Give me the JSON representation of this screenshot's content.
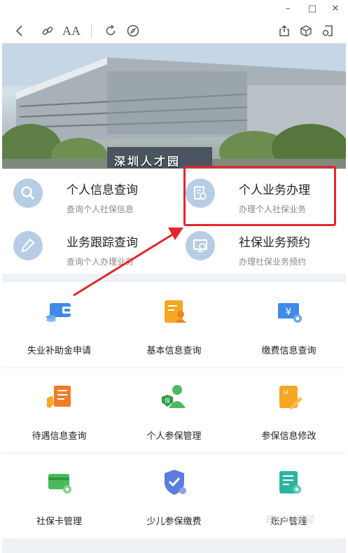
{
  "window": {
    "controls": [
      "minimize-icon",
      "maximize-icon",
      "close-icon"
    ]
  },
  "toolbar": {
    "font_label": "AA",
    "icons": [
      "back-icon",
      "link-icon",
      "font-size-icon",
      "refresh-icon",
      "compass-icon",
      "share-icon",
      "cube-icon",
      "mini-window-icon"
    ]
  },
  "banner": {
    "sign_text": "深圳人才园"
  },
  "quick_services": [
    {
      "title": "个人信息查询",
      "subtitle": "查询个人社保信息",
      "icon": "search-icon"
    },
    {
      "title": "个人业务办理",
      "subtitle": "办理个人社保业务",
      "icon": "document-edit-icon"
    },
    {
      "title": "业务跟踪查询",
      "subtitle": "查询个人办理业务",
      "icon": "pencil-icon"
    },
    {
      "title": "社保业务预约",
      "subtitle": "办理社保业务预约",
      "icon": "monitor-clock-icon"
    }
  ],
  "services": [
    {
      "label": "失业补助金申请",
      "icon": "wallet-icon"
    },
    {
      "label": "基本信息查询",
      "icon": "person-card-icon"
    },
    {
      "label": "缴费信息查询",
      "icon": "yuan-ticket-icon"
    },
    {
      "label": "待遇信息查询",
      "icon": "hand-list-icon"
    },
    {
      "label": "个人参保管理",
      "icon": "insured-person-icon"
    },
    {
      "label": "参保信息修改",
      "icon": "si-edit-icon"
    },
    {
      "label": "社保卡管理",
      "icon": "card-gear-icon"
    },
    {
      "label": "少儿参保缴费",
      "icon": "shield-check-icon"
    },
    {
      "label": "账户管理",
      "icon": "account-gear-icon"
    }
  ],
  "annotation": {
    "highlight_color": "#e3262b"
  },
  "watermark": {
    "text": "Baidu经验"
  },
  "colors": {
    "quick_icon_bg": "#b7cde6",
    "blue": "#3d8be8",
    "orange": "#f5a623",
    "green": "#4cba5c",
    "teal": "#2bb5a0"
  }
}
